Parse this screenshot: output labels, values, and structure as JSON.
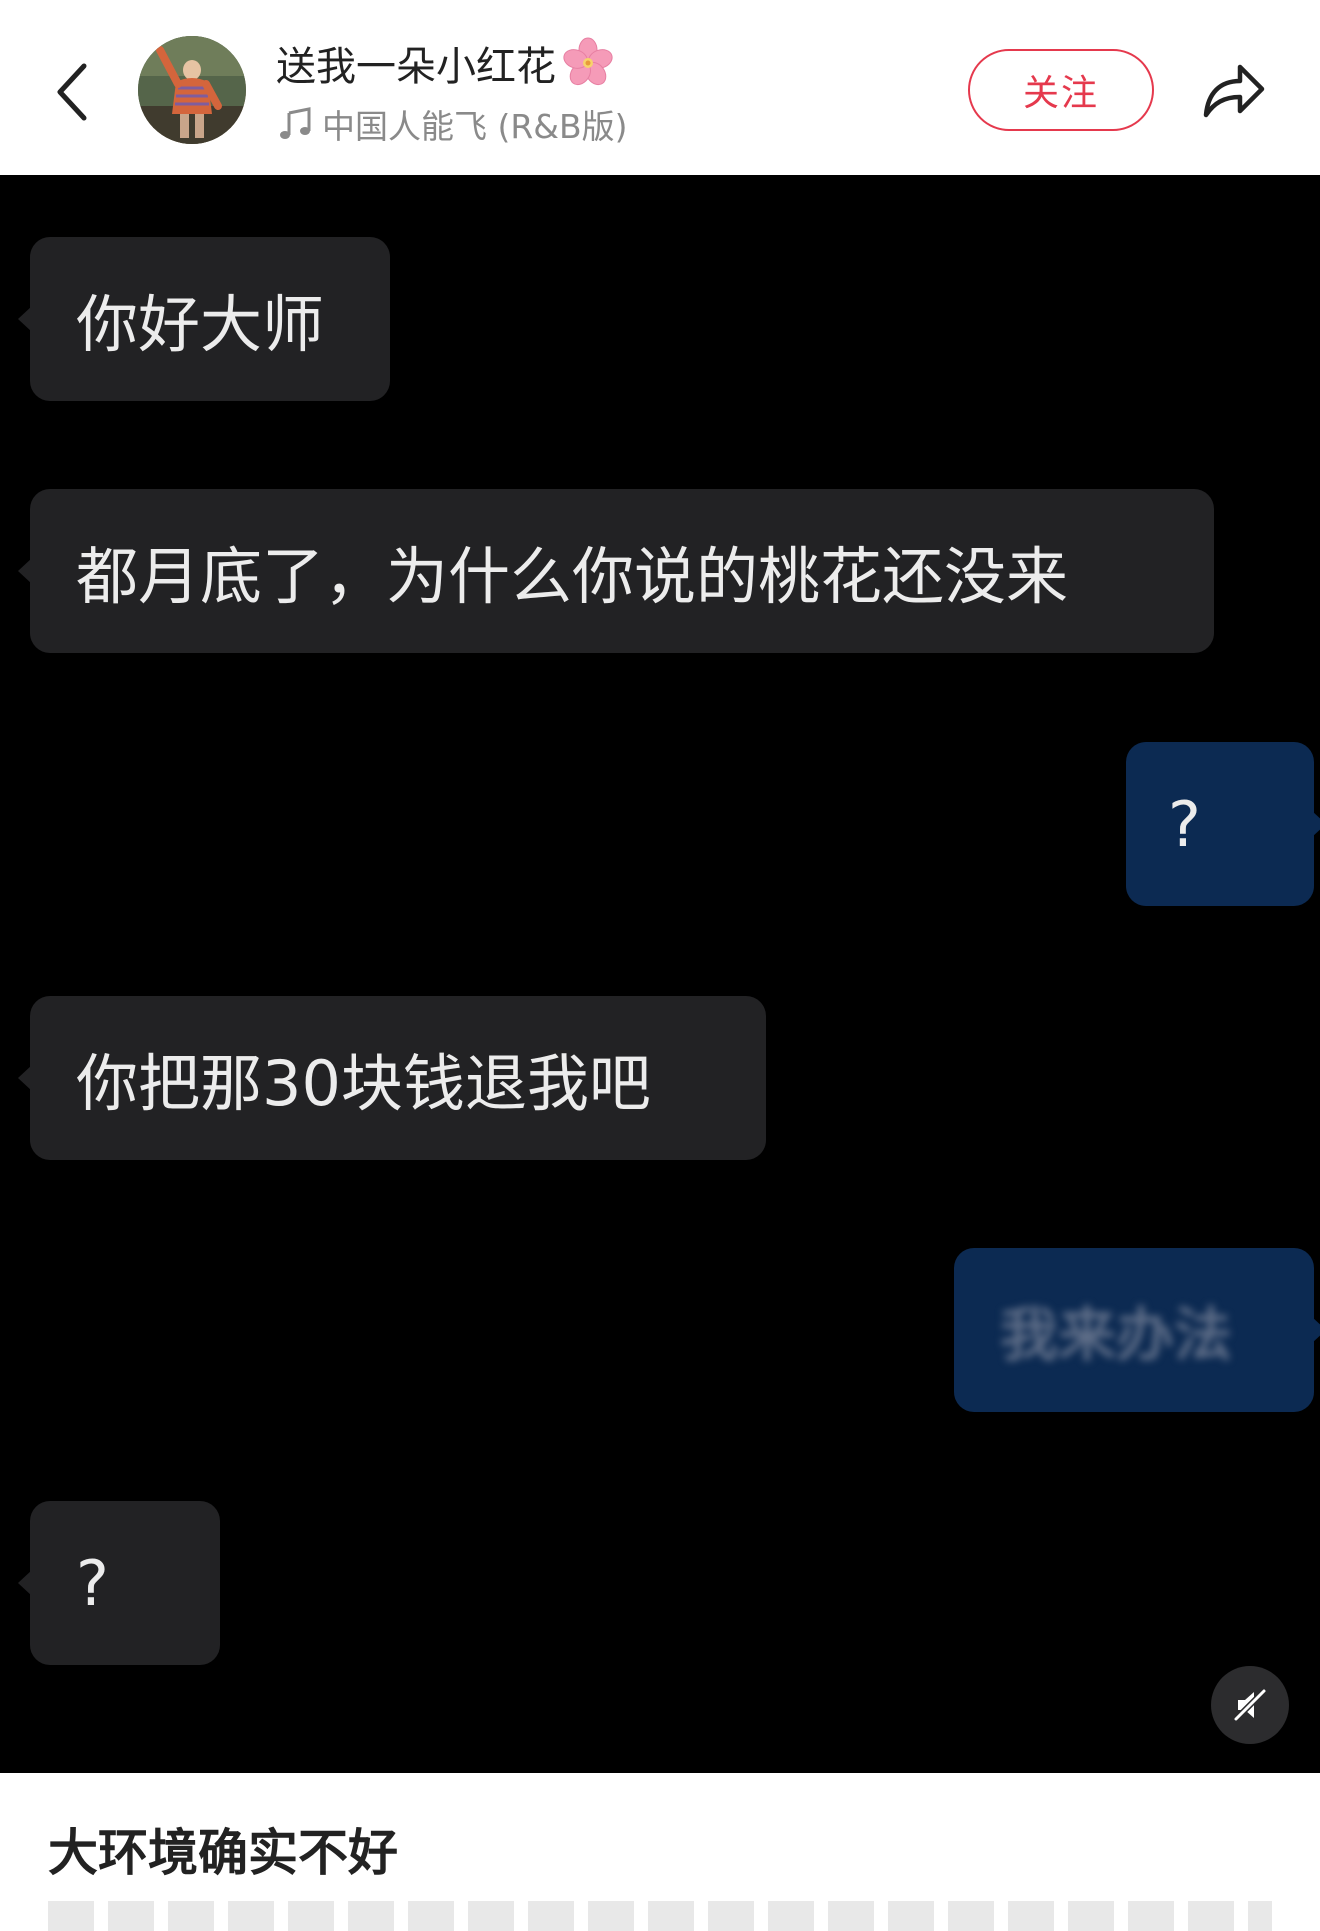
{
  "header": {
    "back_icon": "chevron-left-icon",
    "user_name": "送我一朵小红花",
    "name_emoji": "cherry-blossom-icon",
    "music_icon": "music-note-icon",
    "music_title": "中国人能飞 (R&B版)",
    "follow_label": "关注",
    "share_icon": "share-arrow-icon",
    "accent_color": "#e5394d"
  },
  "chat": {
    "messages": [
      {
        "side": "left",
        "text": "你好大师"
      },
      {
        "side": "left",
        "text": "都月底了，为什么你说的桃花还没来"
      },
      {
        "side": "right",
        "text": "?"
      },
      {
        "side": "left",
        "text": "你把那30块钱退我吧"
      },
      {
        "side": "right",
        "text": "我来办法",
        "blurred": true
      },
      {
        "side": "left",
        "text": "?"
      }
    ],
    "left_bubble_color": "#222224",
    "right_bubble_color": "#0c2a52",
    "mute_icon": "speaker-muted-icon"
  },
  "caption": {
    "title": "大环境确实不好"
  }
}
